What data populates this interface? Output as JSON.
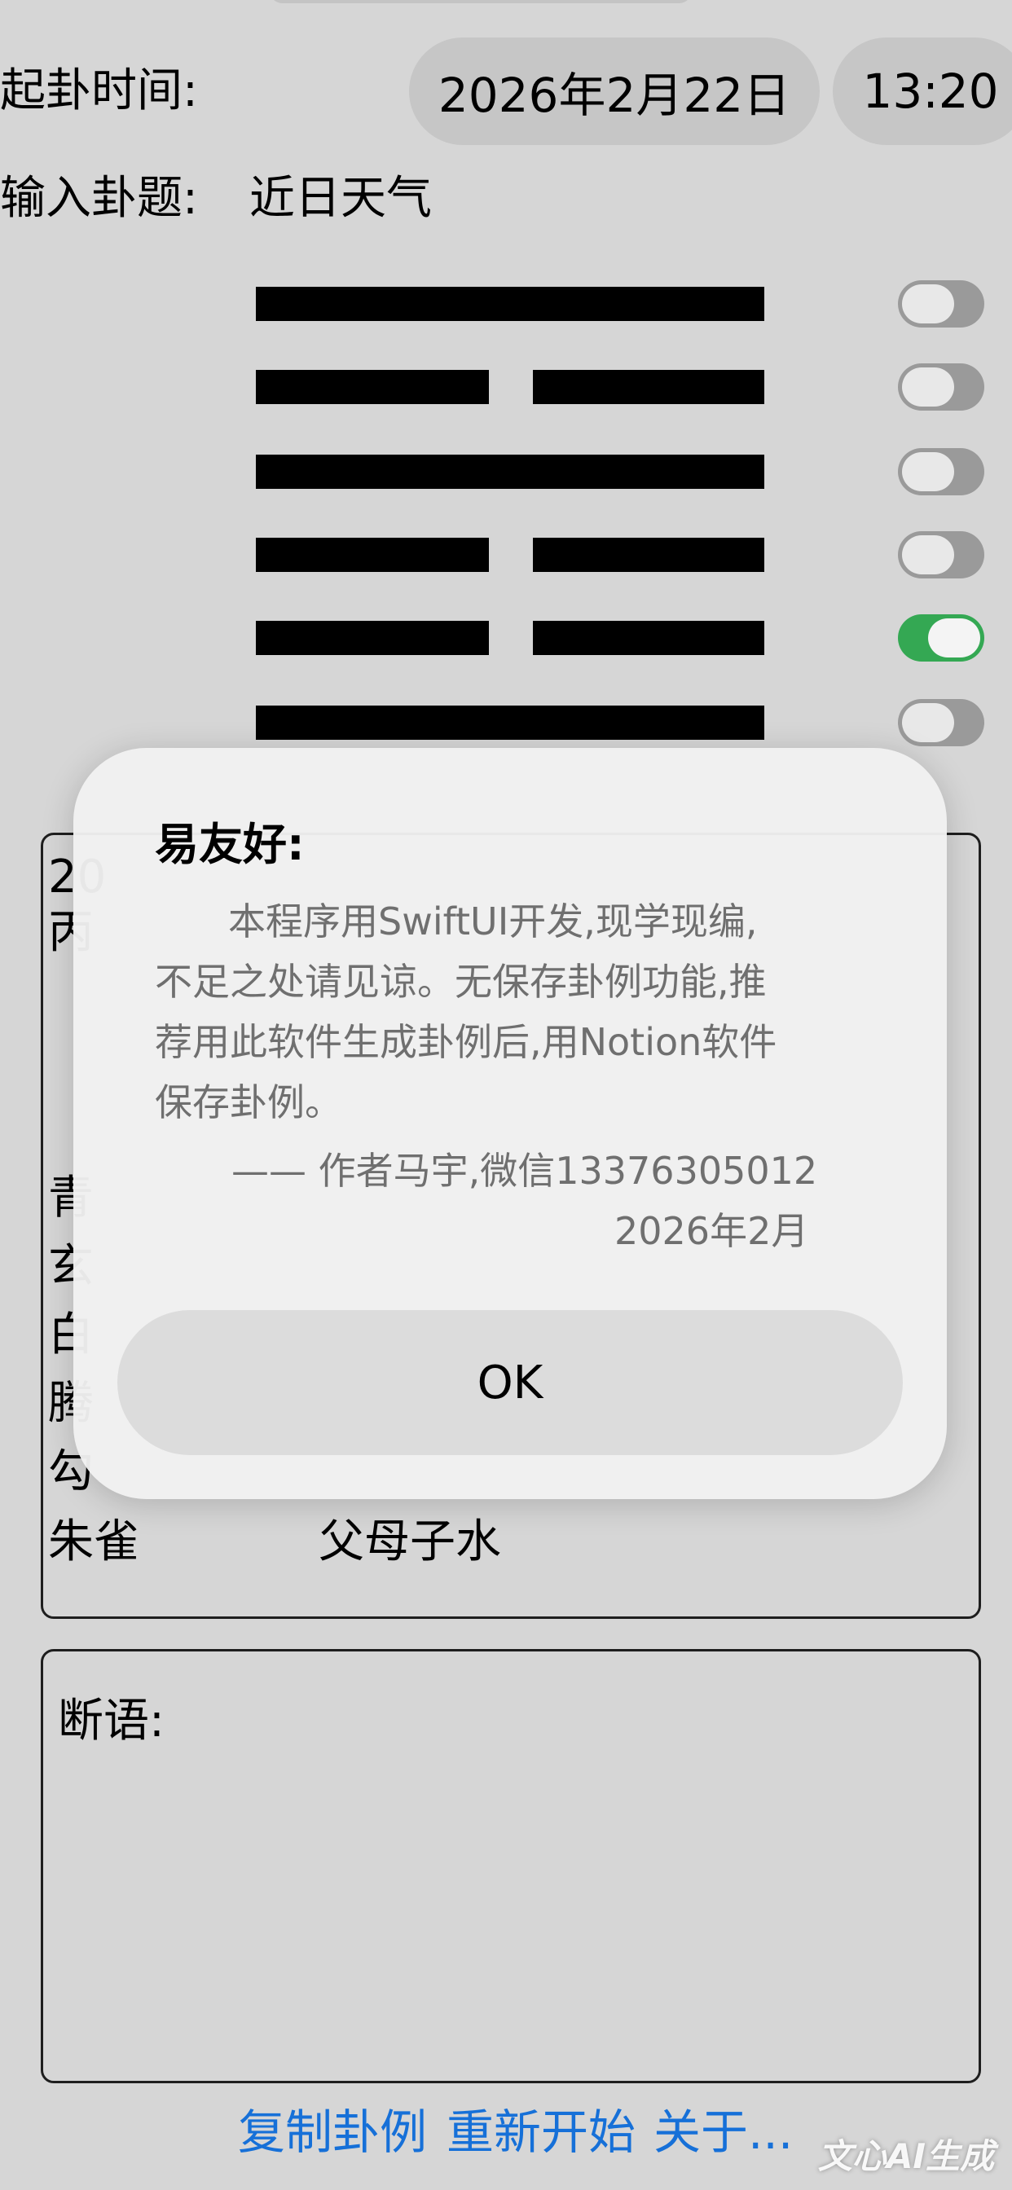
{
  "header": {
    "time_label": "起卦时间:",
    "date": "2026年2月22日",
    "time": "13:20",
    "topic_label": "输入卦题:",
    "topic": "近日天气"
  },
  "hexagram": {
    "lines": [
      {
        "type": "yang",
        "moving": false
      },
      {
        "type": "yin",
        "moving": false
      },
      {
        "type": "yang",
        "moving": false
      },
      {
        "type": "yin",
        "moving": false
      },
      {
        "type": "yin",
        "moving": true
      },
      {
        "type": "yang",
        "moving": false
      }
    ]
  },
  "info": {
    "rows": [
      {
        "left": "20"
      },
      {
        "left": "丙"
      },
      {
        "left": "青"
      },
      {
        "left": "玄"
      },
      {
        "left": "白"
      },
      {
        "left": "腾"
      },
      {
        "left": "勾"
      },
      {
        "left": "朱雀",
        "right": "父母子水"
      }
    ]
  },
  "judgement": {
    "label": "断语:"
  },
  "footer": {
    "copy_label": "复制卦例",
    "restart_label": "重新开始",
    "about_label": "关于..."
  },
  "watermark": "文心AI生成",
  "dialog": {
    "title": "易友好:",
    "body_lines": [
      "本程序用SwiftUI开发,现学现编,",
      "不足之处请见谅。无保存卦例功能,推",
      "荐用此软件生成卦例后,用Notion软件",
      "保存卦例。",
      "—— 作者马宇,微信13376305012",
      "2026年2月"
    ],
    "ok_label": "OK"
  },
  "colors": {
    "background": "#d6d6d6",
    "link": "#1670d8",
    "toggle_on": "#34a853",
    "toggle_off": "#9a9a9a"
  }
}
